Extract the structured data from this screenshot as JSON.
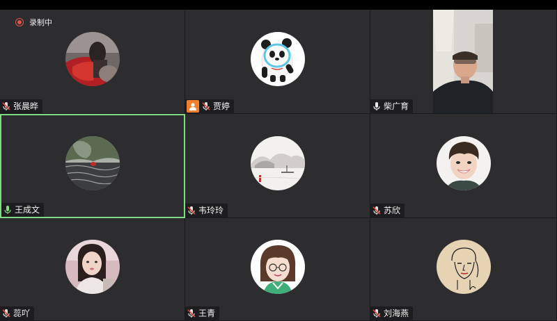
{
  "recording": {
    "label": "录制中",
    "color": "#e0524a"
  },
  "accent": {
    "active_speaker_border": "#7fdc82",
    "host_badge": "#f07f2e"
  },
  "participants": [
    {
      "name": "张晨晔",
      "mic": "muted",
      "avatar": "red-umbrella-photo-avatar"
    },
    {
      "name": "贾婷",
      "mic": "muted",
      "host": true,
      "avatar": "panda-mascot-avatar"
    },
    {
      "name": "柴广育",
      "mic": "on",
      "avatar": "live-camera-video"
    },
    {
      "name": "王成文",
      "mic": "speaking",
      "active": true,
      "avatar": "rocky-river-photo-avatar"
    },
    {
      "name": "韦玲玲",
      "mic": "muted",
      "avatar": "ink-painting-boat-avatar"
    },
    {
      "name": "苏欣",
      "mic": "muted",
      "avatar": "smiling-boy-avatar"
    },
    {
      "name": "蕊吖",
      "mic": "muted",
      "avatar": "girl-photo-avatar"
    },
    {
      "name": "王青",
      "mic": "muted",
      "avatar": "cartoon-girl-glasses-avatar"
    },
    {
      "name": "刘海燕",
      "mic": "muted",
      "avatar": "line-art-woman-avatar"
    }
  ]
}
